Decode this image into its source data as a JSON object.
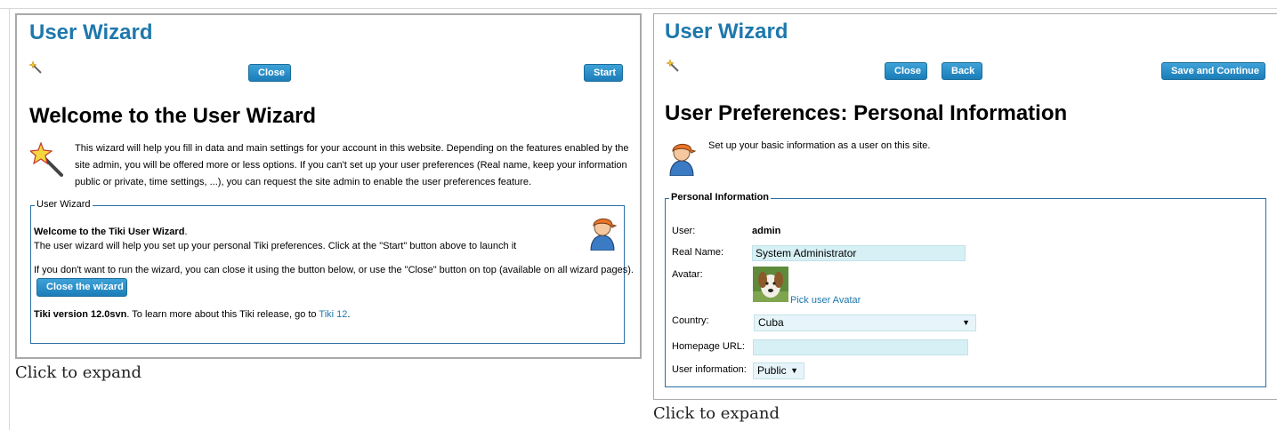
{
  "left_shot": {
    "title": "User Wizard",
    "buttons": {
      "close": "Close",
      "start": "Start"
    },
    "heading": "Welcome to the User Wizard",
    "intro_lines": [
      "This wizard will help you fill in data and main settings for your account in this website. Depending on the features enabled by the",
      "site admin, you will be offered more or less options. If you can't set up your user preferences (Real name, keep your information",
      "public or private, time settings, ...), you can request the site admin to enable the user preferences feature."
    ],
    "fieldset_legend": "User Wizard",
    "welcome_bold": "Welcome to the Tiki User Wizard",
    "welcome_suffix": ".",
    "welcome_line2": "The user wizard will help you set up your personal Tiki preferences. Click at the \"Start\" button above to launch it",
    "close_note": "If you don't want to run the wizard, you can close it using the button below, or use the \"Close\" button on top (available on all wizard pages).",
    "close_wizard_button": "Close the wizard",
    "version_bold": "Tiki version 12.0svn",
    "version_text": ". To learn more about this Tiki release, go to ",
    "version_link": "Tiki 12",
    "version_end": ".",
    "icons": [
      "magic-wand-icon",
      "magic-wand-icon",
      "user-icon"
    ]
  },
  "right_shot": {
    "title": "User Wizard",
    "buttons": {
      "close": "Close",
      "back": "Back",
      "save": "Save and Continue"
    },
    "heading": "User Preferences: Personal Information",
    "intro": "Set up your basic information as a user on this site.",
    "fieldset_legend": "Personal Information",
    "fields": {
      "user_label": "User:",
      "user_value": "admin",
      "real_name_label": "Real Name:",
      "real_name_value": "System Administrator",
      "avatar_label": "Avatar:",
      "avatar_link": "Pick user Avatar",
      "country_label": "Country:",
      "country_value": "Cuba",
      "homepage_label": "Homepage URL:",
      "homepage_value": "",
      "user_info_label": "User information:",
      "user_info_value": "Public"
    },
    "icons": [
      "magic-wand-icon",
      "user-icon",
      "dog-avatar-image",
      "chevron-down-icon"
    ]
  },
  "captions": {
    "left": "Click to expand",
    "right": "Click to expand"
  },
  "colors": {
    "title": "#1e78ac",
    "button": "#2a8ac8",
    "border": "#2a6fa5",
    "input": "#d7f0f6"
  }
}
